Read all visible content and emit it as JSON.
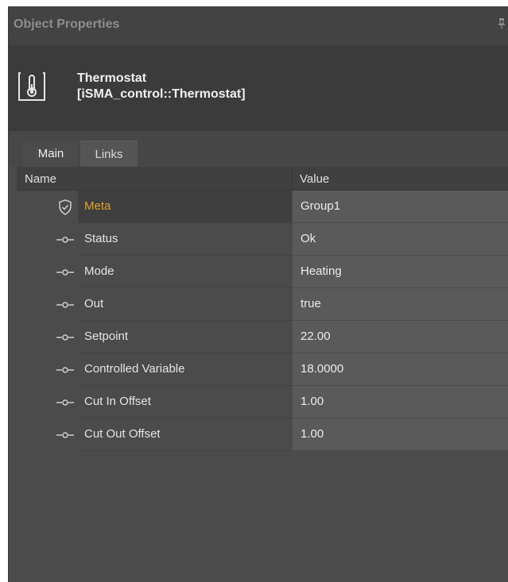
{
  "panel": {
    "title": "Object Properties",
    "pin_icon": "pin-icon"
  },
  "object": {
    "icon": "thermostat-icon",
    "name": "Thermostat",
    "type": "[iSMA_control::Thermostat]"
  },
  "tabs": [
    {
      "label": "Main",
      "active": true
    },
    {
      "label": "Links",
      "active": false
    }
  ],
  "grid": {
    "headers": {
      "name": "Name",
      "value": "Value"
    },
    "rows": [
      {
        "icon": "shield-icon",
        "name": "Meta",
        "value": "Group1"
      },
      {
        "icon": "slot-icon",
        "name": "Status",
        "value": "Ok"
      },
      {
        "icon": "slot-icon",
        "name": "Mode",
        "value": "Heating"
      },
      {
        "icon": "slot-icon",
        "name": "Out",
        "value": "true"
      },
      {
        "icon": "slot-icon",
        "name": "Setpoint",
        "value": "22.00"
      },
      {
        "icon": "slot-icon",
        "name": "Controlled Variable",
        "value": "18.0000"
      },
      {
        "icon": "slot-icon",
        "name": "Cut In Offset",
        "value": "1.00"
      },
      {
        "icon": "slot-icon",
        "name": "Cut Out Offset",
        "value": "1.00"
      }
    ]
  },
  "colors": {
    "meta_label": "#e0a12a",
    "panel_bg": "#4b4b4b",
    "header_bg": "#3b3b3b"
  }
}
